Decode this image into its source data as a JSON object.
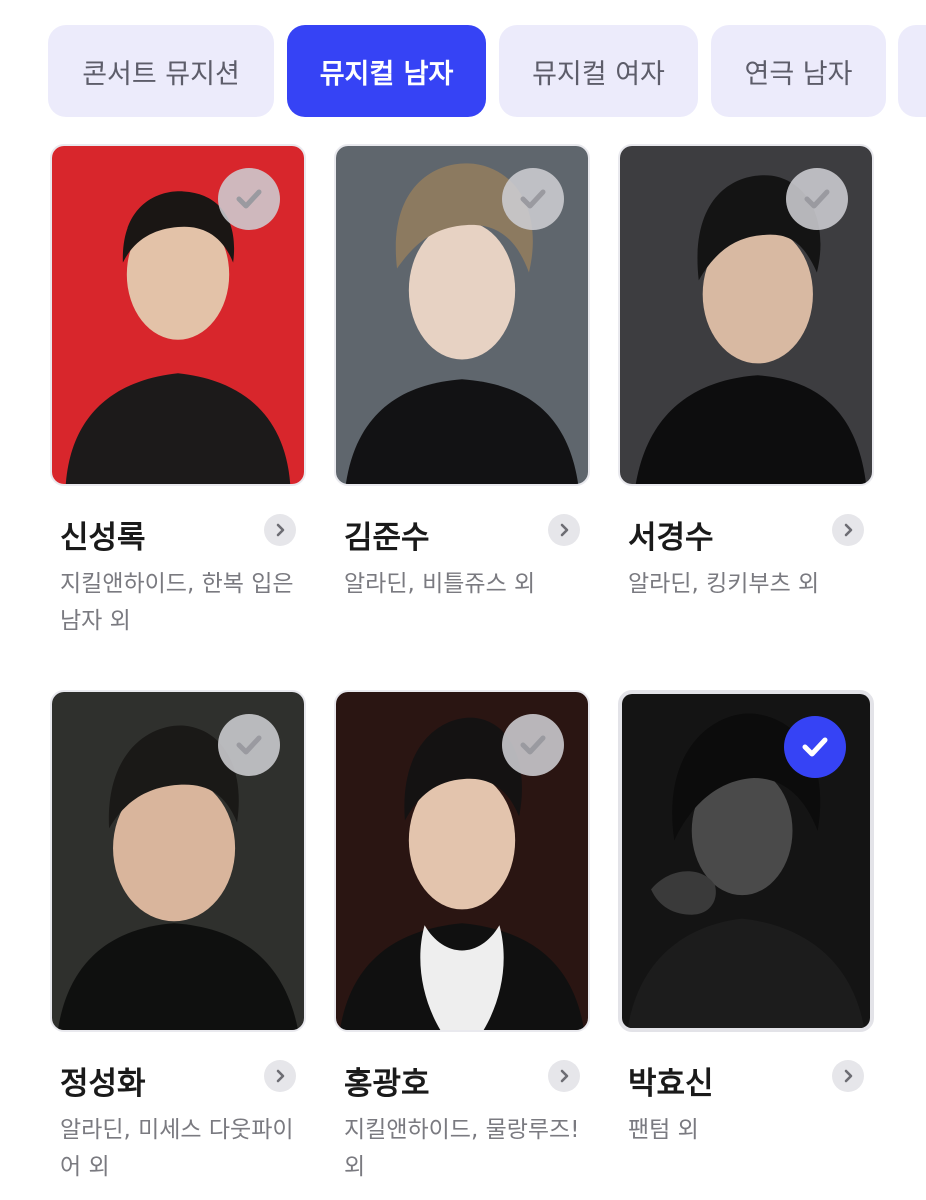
{
  "tabs": [
    {
      "label": "콘서트 뮤지션",
      "active": false
    },
    {
      "label": "뮤지컬 남자",
      "active": true
    },
    {
      "label": "뮤지컬 여자",
      "active": false
    },
    {
      "label": "연극 남자",
      "active": false
    },
    {
      "label": "",
      "active": false
    }
  ],
  "cards": [
    {
      "name": "신성록",
      "works": "지킬앤하이드, 한복 입은 남자 외",
      "selected": false,
      "bg_color": "#d8262c",
      "icon": "portrait-icon"
    },
    {
      "name": "김준수",
      "works": "알라딘, 비틀쥬스 외",
      "selected": false,
      "bg_color": "#5f666d",
      "icon": "portrait-icon"
    },
    {
      "name": "서경수",
      "works": "알라딘, 킹키부츠 외",
      "selected": false,
      "bg_color": "#3d3d40",
      "icon": "portrait-icon"
    },
    {
      "name": "정성화",
      "works": "알라딘, 미세스 다웃파이어 외",
      "selected": false,
      "bg_color": "#2f302d",
      "icon": "portrait-icon"
    },
    {
      "name": "홍광호",
      "works": "지킬앤하이드, 물랑루즈! 외",
      "selected": false,
      "bg_color": "#2a1512",
      "icon": "portrait-icon"
    },
    {
      "name": "박효신",
      "works": "팬텀 외",
      "selected": true,
      "bg_color": "#141414",
      "icon": "portrait-icon"
    }
  ],
  "colors": {
    "accent": "#3643f5",
    "tab_bg": "#ecebfb",
    "check_inactive": "#cdcdd2"
  }
}
